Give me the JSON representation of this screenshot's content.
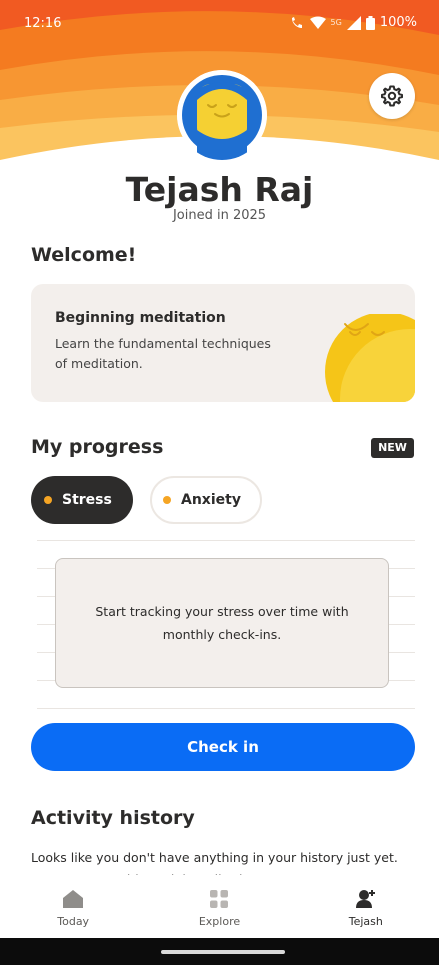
{
  "status_bar": {
    "time": "12:16",
    "network": "5G",
    "battery": "100%"
  },
  "profile": {
    "name": "Tejash Raj",
    "joined": "Joined in 2025",
    "settings_icon": "gear-icon",
    "avatar_icon": "smiling-face-avatar"
  },
  "welcome": {
    "heading": "Welcome!",
    "course": {
      "title": "Beginning meditation",
      "description": "Learn the fundamental techniques of meditation."
    }
  },
  "progress": {
    "heading": "My progress",
    "badge": "NEW",
    "chips": [
      {
        "label": "Stress",
        "selected": true
      },
      {
        "label": "Anxiety",
        "selected": false
      }
    ],
    "empty_message": "Start tracking your stress over time with monthly check-ins.",
    "button": "Check in"
  },
  "activity": {
    "heading": "Activity history",
    "text": "Looks like you don't have anything in your history just yet. Want to start with a mini-meditation?"
  },
  "bottom_nav": {
    "items": [
      {
        "label": "Today",
        "icon": "home-icon"
      },
      {
        "label": "Explore",
        "icon": "grid-icon"
      },
      {
        "label": "Tejash",
        "icon": "profile-icon",
        "active": true
      }
    ]
  },
  "colors": {
    "hero_orange": "#f47b20",
    "accent_blue": "#0a6cf5",
    "dot_orange": "#f5a524",
    "avatar_yellow": "#f5d033",
    "dark": "#2d2c2b"
  }
}
